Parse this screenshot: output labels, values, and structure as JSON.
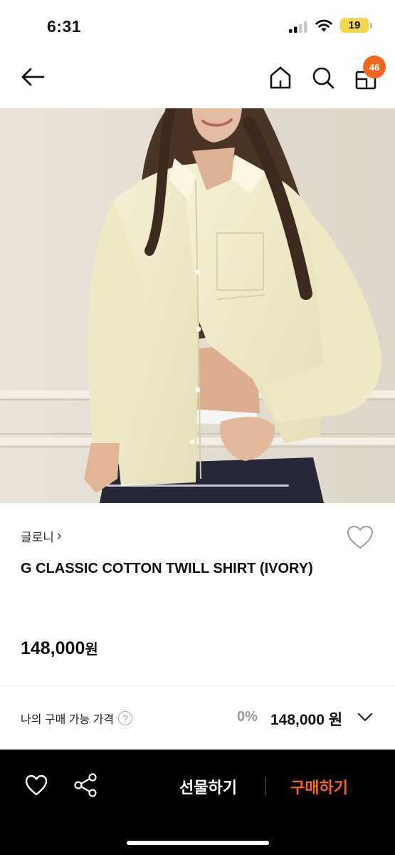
{
  "status_bar": {
    "time": "6:31",
    "battery": "19"
  },
  "nav": {
    "cart_count": "46"
  },
  "product": {
    "brand": "글로니",
    "brand_chevron": "›",
    "title": "G CLASSIC COTTON TWILL SHIRT (IVORY)",
    "price_number": "148,000",
    "price_unit": "원"
  },
  "available_price": {
    "label": "나의 구매 가능 가격",
    "help": "?",
    "discount": "0%",
    "price": "148,000 원"
  },
  "bottom_bar": {
    "gift_label": "선물하기",
    "buy_label": "구매하기"
  },
  "colors": {
    "accent": "#f2661d",
    "battery": "#f2d84b",
    "bottom_bar_bg": "#000000",
    "shirt": "#f1ebc7"
  }
}
